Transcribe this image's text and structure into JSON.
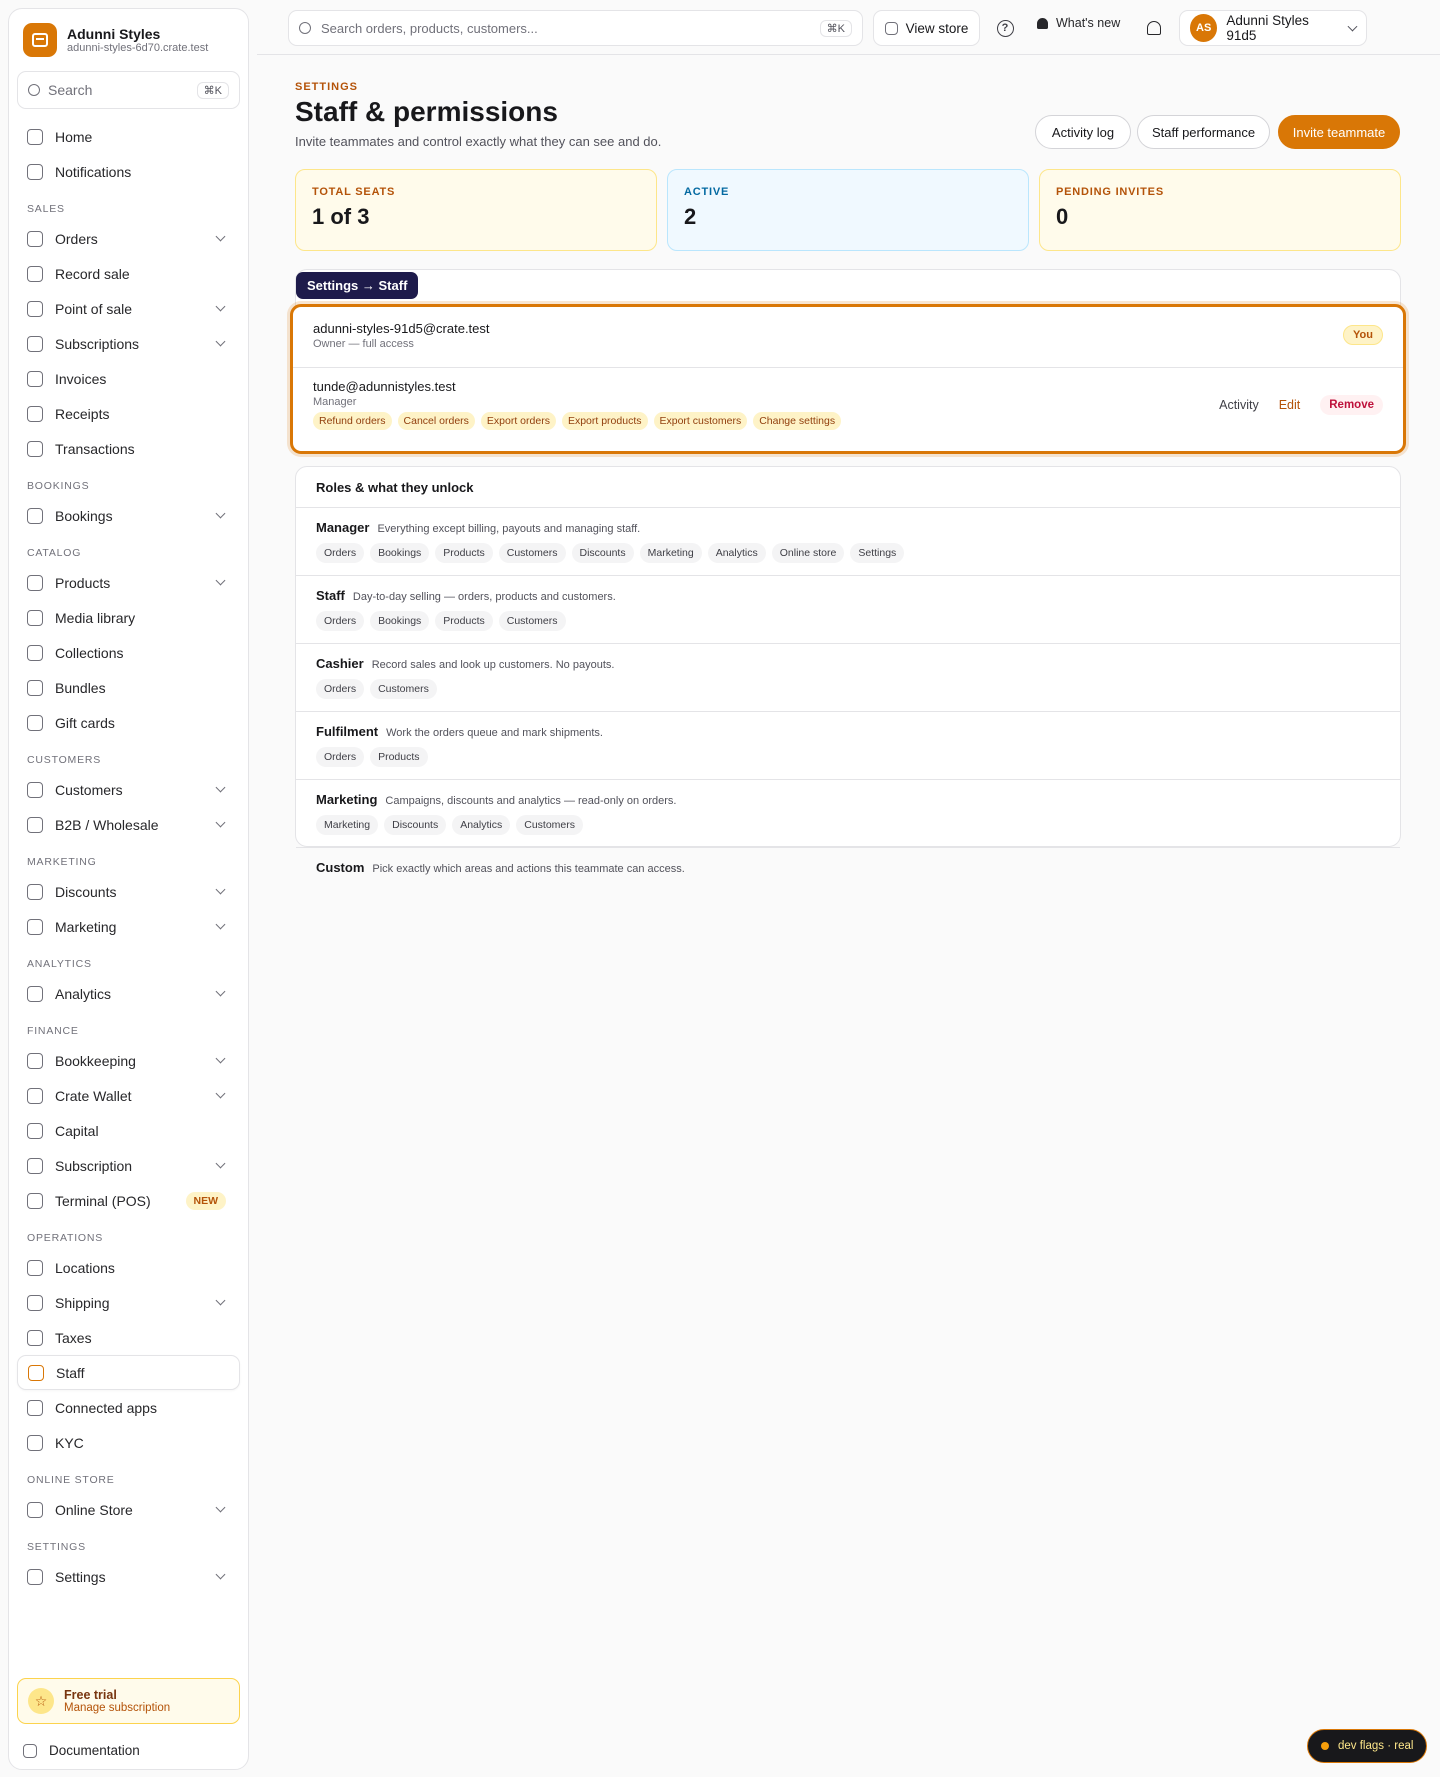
{
  "brand": {
    "name": "Adunni Styles",
    "domain": "adunni-styles-6d70.crate.test"
  },
  "sidebar": {
    "search_placeholder": "Search",
    "search_kbd": "⌘K",
    "top_items": [
      {
        "label": "Home",
        "icon": "home-icon"
      },
      {
        "label": "Notifications",
        "icon": "chat-bubble-icon"
      }
    ],
    "groups": [
      {
        "title": "SALES",
        "items": [
          {
            "label": "Orders",
            "chevron": true
          },
          {
            "label": "Record sale",
            "chevron": false
          },
          {
            "label": "Point of sale",
            "chevron": true
          },
          {
            "label": "Subscriptions",
            "chevron": true
          },
          {
            "label": "Invoices",
            "chevron": false
          },
          {
            "label": "Receipts",
            "chevron": false
          },
          {
            "label": "Transactions",
            "chevron": false
          }
        ]
      },
      {
        "title": "BOOKINGS",
        "items": [
          {
            "label": "Bookings",
            "chevron": true
          }
        ]
      },
      {
        "title": "CATALOG",
        "items": [
          {
            "label": "Products",
            "chevron": true
          },
          {
            "label": "Media library",
            "chevron": false
          },
          {
            "label": "Collections",
            "chevron": false
          },
          {
            "label": "Bundles",
            "chevron": false
          },
          {
            "label": "Gift cards",
            "chevron": false
          }
        ]
      },
      {
        "title": "CUSTOMERS",
        "items": [
          {
            "label": "Customers",
            "chevron": true
          },
          {
            "label": "B2B / Wholesale",
            "chevron": true
          }
        ]
      },
      {
        "title": "MARKETING",
        "items": [
          {
            "label": "Discounts",
            "chevron": true
          },
          {
            "label": "Marketing",
            "chevron": true
          }
        ]
      },
      {
        "title": "ANALYTICS",
        "items": [
          {
            "label": "Analytics",
            "chevron": true
          }
        ]
      },
      {
        "title": "FINANCE",
        "items": [
          {
            "label": "Bookkeeping",
            "chevron": true
          },
          {
            "label": "Crate Wallet",
            "chevron": true
          },
          {
            "label": "Capital",
            "chevron": false
          },
          {
            "label": "Subscription",
            "chevron": true
          },
          {
            "label": "Terminal (POS)",
            "chevron": false,
            "badge": "NEW"
          }
        ]
      },
      {
        "title": "OPERATIONS",
        "items": [
          {
            "label": "Locations",
            "chevron": false
          },
          {
            "label": "Shipping",
            "chevron": true
          },
          {
            "label": "Taxes",
            "chevron": false
          },
          {
            "label": "Staff",
            "chevron": false,
            "active": true
          },
          {
            "label": "Connected apps",
            "chevron": false
          },
          {
            "label": "KYC",
            "chevron": false
          }
        ]
      },
      {
        "title": "ONLINE STORE",
        "items": [
          {
            "label": "Online Store",
            "chevron": true
          }
        ]
      },
      {
        "title": "SETTINGS",
        "items": [
          {
            "label": "Settings",
            "chevron": true
          }
        ]
      }
    ],
    "trial": {
      "title": "Free trial",
      "subtitle": "Manage subscription"
    },
    "docs_label": "Documentation"
  },
  "topbar": {
    "search_placeholder": "Search orders, products, customers...",
    "search_kbd": "⌘K",
    "view_store": "View store",
    "whats_new": "What's new",
    "account_initials": "AS",
    "account_name": "Adunni Styles 91d5"
  },
  "page": {
    "eyebrow": "SETTINGS",
    "title": "Staff & permissions",
    "subtitle": "Invite teammates and control exactly what they can see and do.",
    "buttons": {
      "activity_log": "Activity log",
      "staff_performance": "Staff performance",
      "invite": "Invite teammate"
    }
  },
  "stats": [
    {
      "label": "TOTAL SEATS",
      "value": "1 of 3"
    },
    {
      "label": "ACTIVE",
      "value": "2"
    },
    {
      "label": "PENDING INVITES",
      "value": "0"
    }
  ],
  "tooltip": "Settings → Staff",
  "members": [
    {
      "email": "adunni-styles-91d5@crate.test",
      "role": "Owner — full access",
      "tag": "You"
    },
    {
      "email": "tunde@adunnistyles.test",
      "role": "Manager",
      "permissions": [
        "Refund orders",
        "Cancel orders",
        "Export orders",
        "Export products",
        "Export customers",
        "Change settings"
      ],
      "actions": {
        "activity": "Activity",
        "edit": "Edit",
        "remove": "Remove"
      }
    }
  ],
  "roles": {
    "heading": "Roles & what they unlock",
    "items": [
      {
        "name": "Manager",
        "desc": "Everything except billing, payouts and managing staff.",
        "areas": [
          "Orders",
          "Bookings",
          "Products",
          "Customers",
          "Discounts",
          "Marketing",
          "Analytics",
          "Online store",
          "Settings"
        ]
      },
      {
        "name": "Staff",
        "desc": "Day-to-day selling — orders, products and customers.",
        "areas": [
          "Orders",
          "Bookings",
          "Products",
          "Customers"
        ]
      },
      {
        "name": "Cashier",
        "desc": "Record sales and look up customers. No payouts.",
        "areas": [
          "Orders",
          "Customers"
        ]
      },
      {
        "name": "Fulfilment",
        "desc": "Work the orders queue and mark shipments.",
        "areas": [
          "Orders",
          "Products"
        ]
      },
      {
        "name": "Marketing",
        "desc": "Campaigns, discounts and analytics — read-only on orders.",
        "areas": [
          "Marketing",
          "Discounts",
          "Analytics",
          "Customers"
        ]
      },
      {
        "name": "Custom",
        "desc": "Pick exactly which areas and actions this teammate can access.",
        "areas": []
      }
    ]
  },
  "dev_flags": "dev flags · real",
  "colors": {
    "accent": "#d97706",
    "accent_soft": "#fef3c7",
    "danger": "#be123c",
    "info": "#0369a1"
  }
}
